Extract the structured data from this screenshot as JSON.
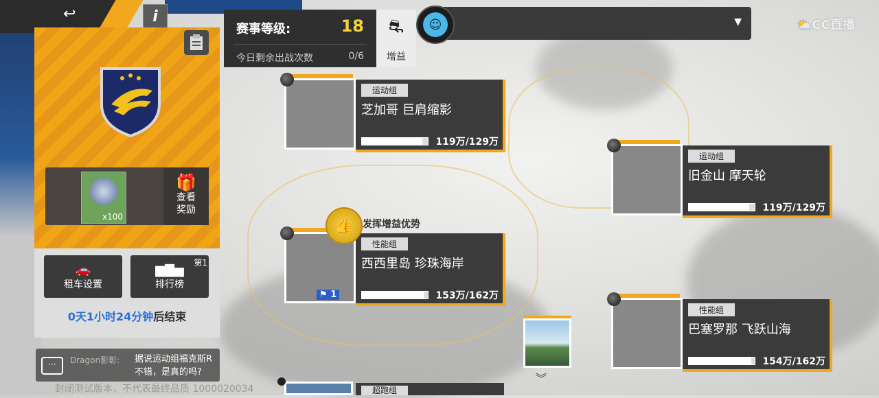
{
  "status": {
    "level_label": "赛事等级:",
    "level_value": "18",
    "remaining_label": "今日剩余出战次数",
    "remaining_value": "0/6",
    "buff_label": "增益"
  },
  "left_panel": {
    "reward_qty": "x100",
    "check_reward_line1": "查看",
    "check_reward_line2": "奖励",
    "rent_label": "租车设置",
    "rank_label": "排行榜",
    "rank_badge": "第1",
    "countdown_time": "0天1小时24分钟",
    "countdown_suffix": "后结束"
  },
  "chat": {
    "name": "Dragon影彰:",
    "text_line1": "据说运动组福克斯R",
    "text_line2": "不错，是真的吗?"
  },
  "watermark": "封闭测试版本，不代表最终品质 1000020034",
  "logo": "CC直播",
  "advantage_text": "发挥增益优势",
  "cards": [
    {
      "tag": "运动组",
      "title": "芝加哥 巨肩缩影",
      "score": "119万/129万",
      "progress": 0.92
    },
    {
      "tag": "运动组",
      "title": "旧金山 摩天轮",
      "score": "119万/129万",
      "progress": 0.92
    },
    {
      "tag": "性能组",
      "title": "西西里岛 珍珠海岸",
      "score": "153万/162万",
      "progress": 0.94,
      "player_count": "1"
    },
    {
      "tag": "性能组",
      "title": "巴塞罗那 飞跃山海",
      "score": "154万/162万",
      "progress": 0.95
    }
  ],
  "bottom_card_tag": "超跑组",
  "colors": {
    "accent": "#f2a81c",
    "level": "#f5d33a",
    "timer": "#2a6fd8"
  }
}
